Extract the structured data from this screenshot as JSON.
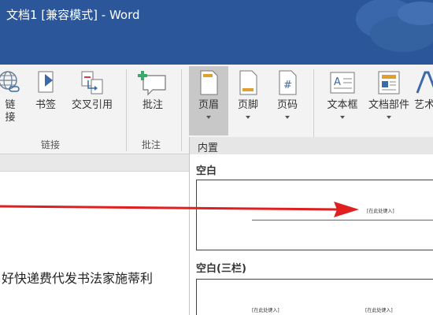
{
  "window": {
    "title": "文档1 [兼容模式]  -  Word"
  },
  "ribbon": {
    "groups": {
      "links_label": "链接",
      "comments_label": "批注"
    },
    "buttons": {
      "link_label_1": "链",
      "link_label_2": "接",
      "bookmark": "书签",
      "cross_reference": "交叉引用",
      "comment": "批注",
      "header": "页眉",
      "footer": "页脚",
      "page_number": "页码",
      "text_box": "文本框",
      "quick_parts": "文档部件",
      "wordart": "艺术"
    }
  },
  "document": {
    "body_text": "好快递费代发书法家施蒂利"
  },
  "header_gallery": {
    "section_title": "内置",
    "items": [
      {
        "title": "空白",
        "placeholder": "[在此处键入]"
      },
      {
        "title": "空白(三栏)",
        "placeholder_left": "[在此处键入]",
        "placeholder_right": "[在此处键入]"
      }
    ]
  },
  "colors": {
    "title_bar": "#2b579a",
    "ribbon_bg": "#f3f3f3",
    "arrow": "#e02020"
  }
}
